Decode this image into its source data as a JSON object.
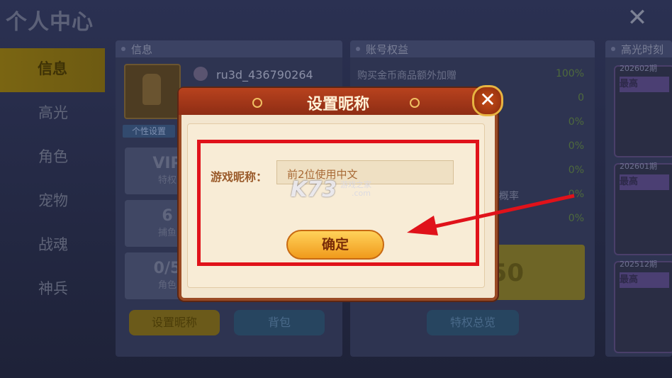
{
  "page_title": "个人中心",
  "nav": [
    "信息",
    "高光",
    "角色",
    "宠物",
    "战魂",
    "神兵"
  ],
  "info_panel": {
    "header": "信息",
    "username": "ru3d_436790264",
    "custom_tag": "个性设置",
    "stats": [
      {
        "big": "VIP",
        "small": "特权"
      },
      {
        "big": "6",
        "small": "捕鱼"
      },
      {
        "big": "0/5",
        "small": "角色"
      }
    ],
    "set_nickname_button": "设置昵称",
    "backpack_button": "背包"
  },
  "account_panel": {
    "header": "账号权益",
    "rows": [
      {
        "label": "购买金币商品额外加赠",
        "value": "100%"
      },
      {
        "label": "",
        "value": "0"
      },
      {
        "label": "",
        "value": "0%"
      },
      {
        "label": "",
        "value": "0%"
      },
      {
        "label": "",
        "value": "0%"
      },
      {
        "label": "倍概率",
        "value": "0%"
      },
      {
        "label": "",
        "value": "0%"
      }
    ],
    "gold_number": "50",
    "privilege_button": "特权总览"
  },
  "highlight_panel": {
    "header": "高光时刻",
    "cards": [
      {
        "period": "202602期",
        "badge": "最高"
      },
      {
        "period": "202601期",
        "badge": "最高"
      },
      {
        "period": "202512期",
        "badge": "最高"
      }
    ]
  },
  "dialog": {
    "title": "设置昵称",
    "label": "游戏昵称：",
    "placeholder": "前2位使用中文",
    "confirm": "确定",
    "close": "✕"
  },
  "watermark": {
    "main": "K73",
    "sub": "游戏之家",
    "domain": ".com"
  },
  "colors": {
    "annotation_red": "#e0121a",
    "dialog_header": "#a83a1a",
    "button_gold": "#f5b83a"
  }
}
